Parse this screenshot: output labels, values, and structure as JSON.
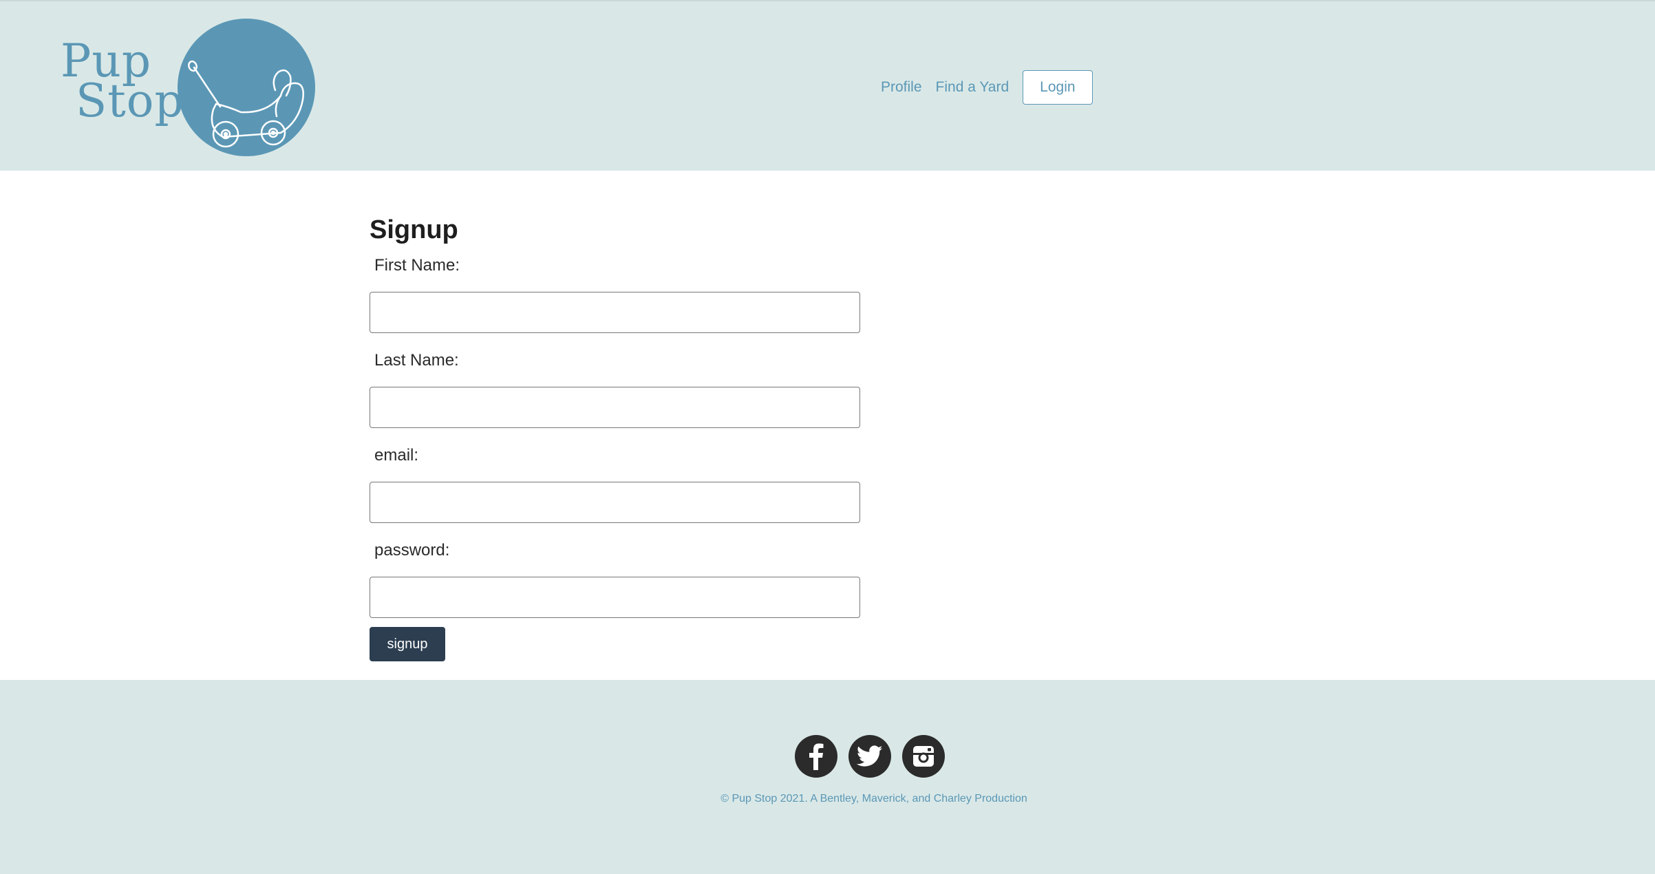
{
  "header": {
    "logo": {
      "line1": "Pup",
      "line2": "Stop"
    },
    "nav": {
      "profile": "Profile",
      "find_yard": "Find a Yard",
      "login": "Login"
    }
  },
  "signup": {
    "title": "Signup",
    "fields": [
      {
        "label": "First Name:",
        "value": ""
      },
      {
        "label": "Last Name:",
        "value": ""
      },
      {
        "label": "email:",
        "value": ""
      },
      {
        "label": "password:",
        "value": ""
      }
    ],
    "button": "signup"
  },
  "footer": {
    "social": [
      "facebook-icon",
      "twitter-icon",
      "instagram-icon"
    ],
    "copyright": "© Pup Stop 2021. A Bentley, Maverick, and Charley Production"
  },
  "colors": {
    "header_bg": "#d9e8e7",
    "accent": "#5b97b5",
    "button_dark": "#2c3e50",
    "social_icon": "#2b2b2b"
  }
}
